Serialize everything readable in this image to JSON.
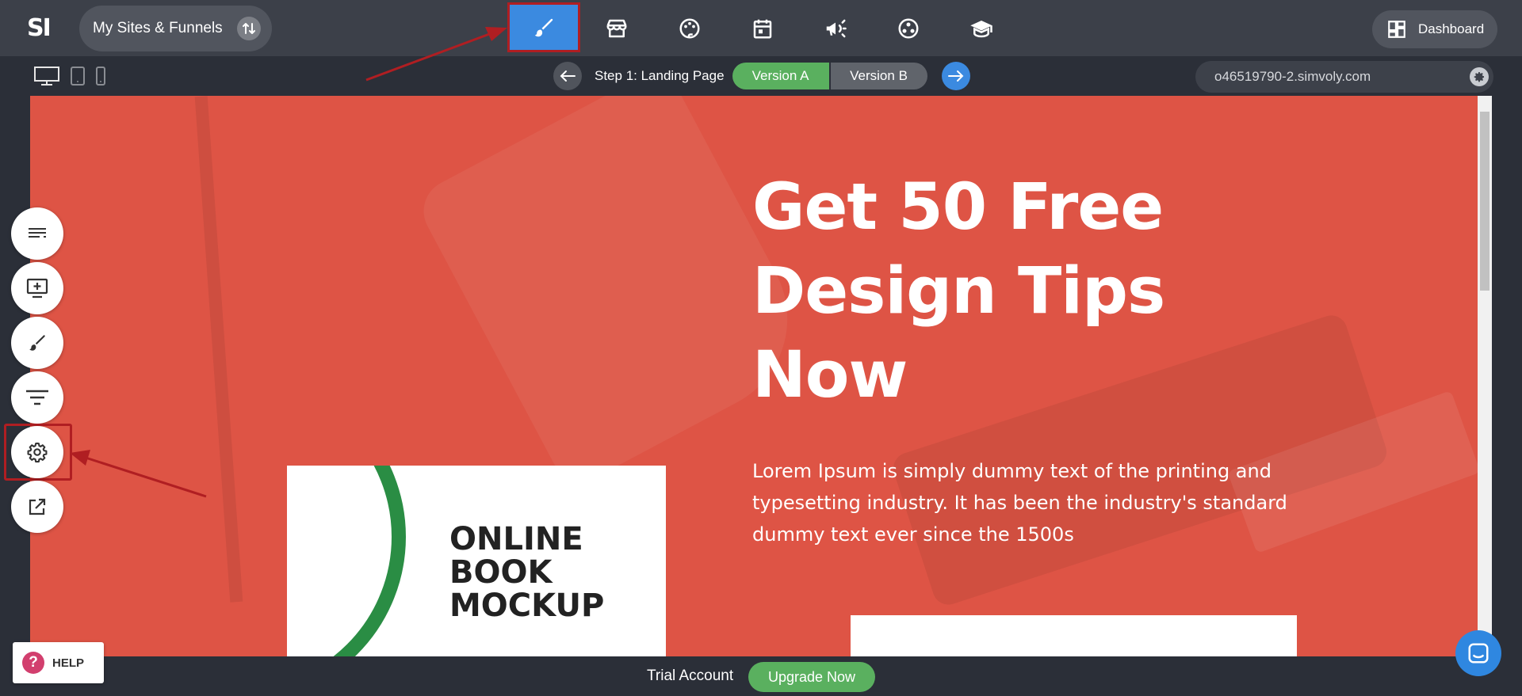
{
  "topbar": {
    "logo": "SI",
    "sites_label": "My Sites & Funnels",
    "nav_icons": [
      "brush-icon",
      "store-icon",
      "palette-icon",
      "calendar-icon",
      "megaphone-icon",
      "community-icon",
      "graduation-cap-icon"
    ],
    "dashboard_label": "Dashboard"
  },
  "subbar": {
    "devices": [
      "desktop-icon",
      "tablet-icon",
      "mobile-icon"
    ],
    "step_label": "Step 1: Landing Page",
    "version_a": "Version A",
    "version_b": "Version B",
    "domain": "o46519790-2.simvoly.com"
  },
  "canvas": {
    "hero_title": "Get 50 Free Design Tips Now",
    "hero_text": "Lorem Ipsum is simply dummy text of the printing and typesetting industry. It has been the industry's standard dummy text ever since the 1500s",
    "book_title": "ONLINE BOOK MOCKUP"
  },
  "tools": [
    "sections-icon",
    "add-element-icon",
    "brush-icon",
    "filter-icon",
    "settings-icon",
    "open-external-icon"
  ],
  "bottom": {
    "trial_label": "Trial Account",
    "upgrade_label": "Upgrade Now",
    "help_label": "HELP",
    "help_glyph": "?"
  },
  "colors": {
    "accent_blue": "#3b8ae0",
    "green": "#5ab05f",
    "canvas_red": "#de5445",
    "highlight_red": "#b01e22"
  }
}
